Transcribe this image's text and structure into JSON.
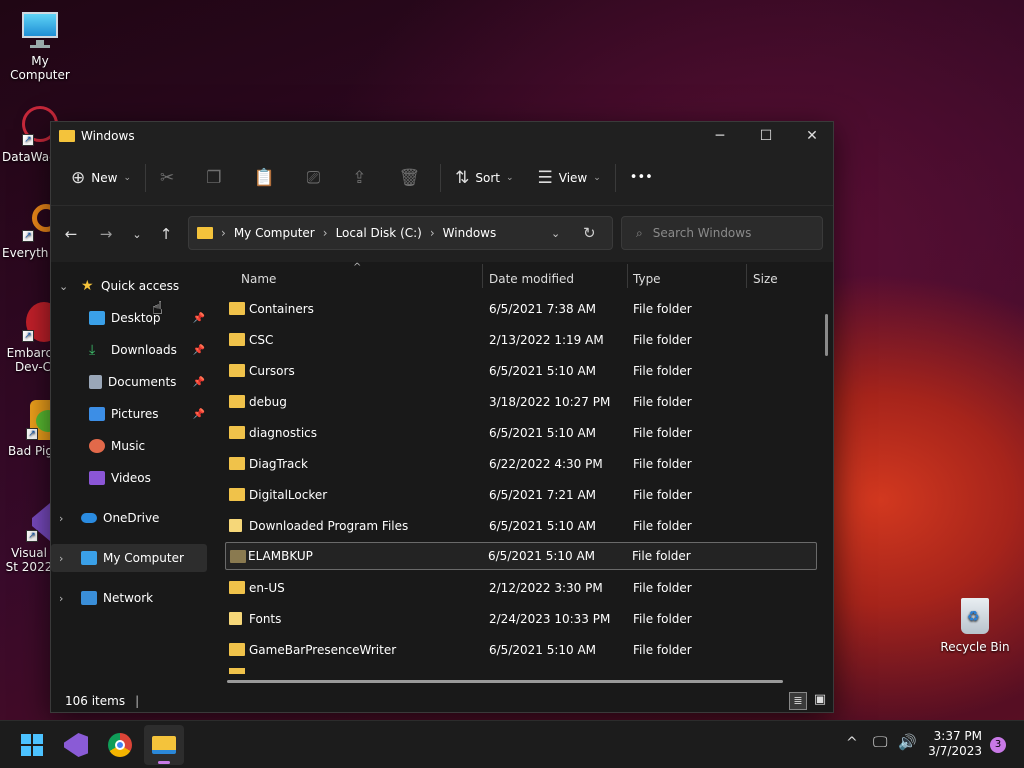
{
  "desktop": {
    "icons": [
      {
        "label": "My Computer",
        "icon": "monitor-icon"
      },
      {
        "label": "DataWag",
        "icon": "datawag-icon"
      },
      {
        "label": "Everyth",
        "icon": "everything-search-icon"
      },
      {
        "label": "Embarca Dev-C",
        "icon": "devcpp-icon"
      },
      {
        "label": "Bad Pig",
        "icon": "bad-piggies-icon"
      },
      {
        "label": "Visual St 2022",
        "icon": "visual-studio-icon"
      },
      {
        "label": "Recycle Bin",
        "icon": "recycle-bin-icon"
      }
    ]
  },
  "window": {
    "title": "Windows",
    "toolbar": {
      "new_label": "New",
      "sort_label": "Sort",
      "view_label": "View",
      "more_label": "•••"
    },
    "address": {
      "breadcrumb": [
        "My Computer",
        "Local Disk (C:)",
        "Windows"
      ]
    },
    "search": {
      "placeholder": "Search Windows"
    },
    "sidebar": {
      "quick_access": "Quick access",
      "pinned": [
        {
          "label": "Desktop",
          "pinned": true,
          "color": "#3aa0e8"
        },
        {
          "label": "Downloads",
          "pinned": true,
          "color": "#3ec46d"
        },
        {
          "label": "Documents",
          "pinned": true,
          "color": "#9aa7b8"
        },
        {
          "label": "Pictures",
          "pinned": true,
          "color": "#3c8ee6"
        },
        {
          "label": "Music",
          "pinned": false,
          "color": "#e2694a"
        },
        {
          "label": "Videos",
          "pinned": false,
          "color": "#8b56d6"
        }
      ],
      "onedrive": "OneDrive",
      "this_pc": "My Computer",
      "network": "Network"
    },
    "columns": {
      "name": "Name",
      "date": "Date modified",
      "type": "Type",
      "size": "Size"
    },
    "files": [
      {
        "name": "Containers",
        "date": "6/5/2021 7:38 AM",
        "type": "File folder"
      },
      {
        "name": "CSC",
        "date": "2/13/2022 1:19 AM",
        "type": "File folder"
      },
      {
        "name": "Cursors",
        "date": "6/5/2021 5:10 AM",
        "type": "File folder"
      },
      {
        "name": "debug",
        "date": "3/18/2022 10:27 PM",
        "type": "File folder"
      },
      {
        "name": "diagnostics",
        "date": "6/5/2021 5:10 AM",
        "type": "File folder"
      },
      {
        "name": "DiagTrack",
        "date": "6/22/2022 4:30 PM",
        "type": "File folder"
      },
      {
        "name": "DigitalLocker",
        "date": "6/5/2021 7:21 AM",
        "type": "File folder"
      },
      {
        "name": "Downloaded Program Files",
        "date": "6/5/2021 5:10 AM",
        "type": "File folder"
      },
      {
        "name": "ELAMBKUP",
        "date": "6/5/2021 5:10 AM",
        "type": "File folder"
      },
      {
        "name": "en-US",
        "date": "2/12/2022 3:30 PM",
        "type": "File folder"
      },
      {
        "name": "Fonts",
        "date": "2/24/2023 10:33 PM",
        "type": "File folder"
      },
      {
        "name": "GameBarPresenceWriter",
        "date": "6/5/2021 5:10 AM",
        "type": "File folder"
      }
    ],
    "status": {
      "item_count": "106 items"
    }
  },
  "taskbar": {
    "time": "3:37 PM",
    "date": "3/7/2023",
    "notifications": "3"
  }
}
